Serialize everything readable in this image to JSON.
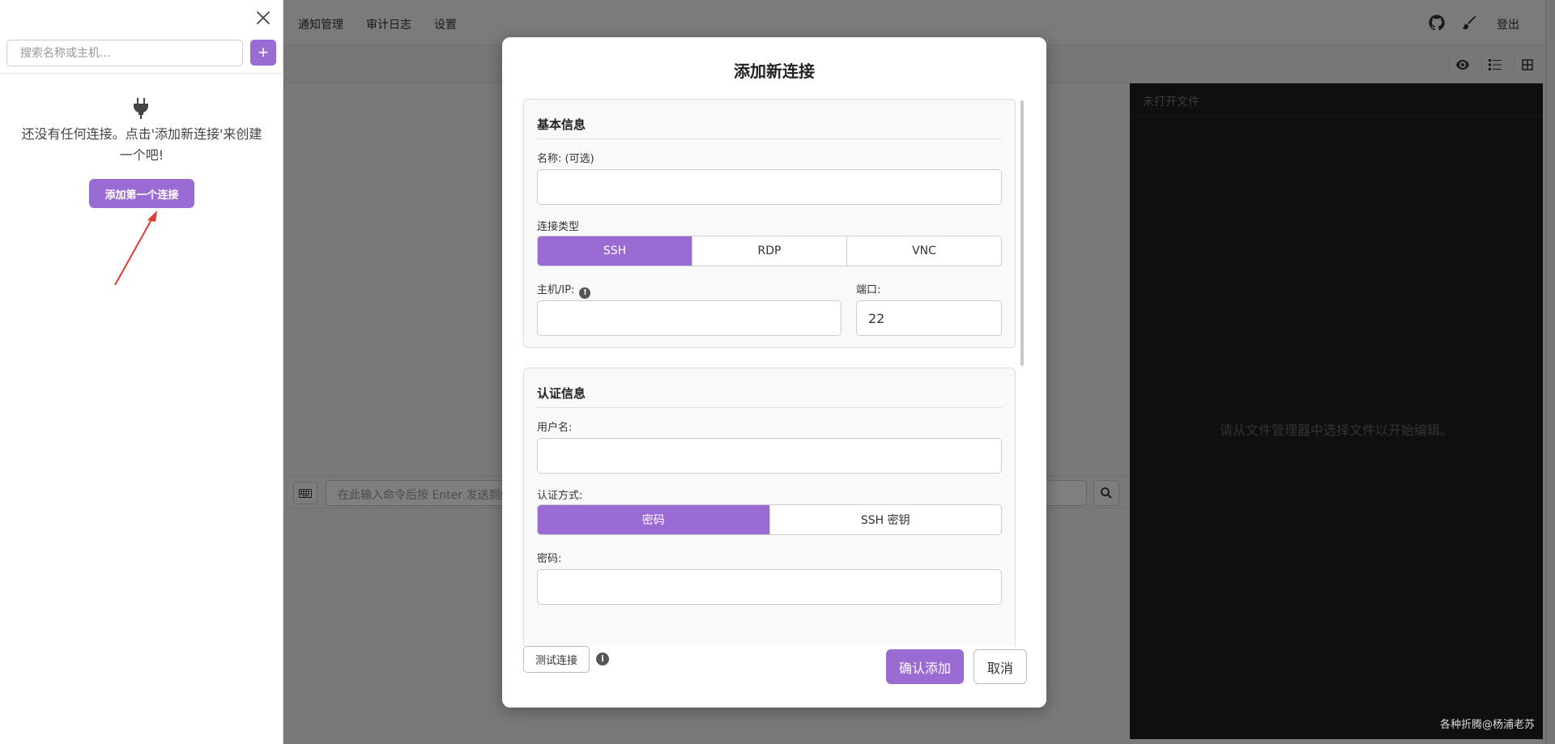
{
  "topnav": {
    "items": [
      "通知管理",
      "审计日志",
      "设置"
    ],
    "logout": "登出",
    "icons": [
      "github-icon",
      "brush-icon"
    ]
  },
  "tabbar": {
    "tools": [
      "eye-icon",
      "list-icon",
      "grid-icon"
    ]
  },
  "editor": {
    "header": "未打开文件",
    "empty_message": "请从文件管理器中选择文件以开始编辑。"
  },
  "command_bar": {
    "placeholder": "在此输入命令后按 Enter 发送到终端..."
  },
  "sidebar": {
    "search_placeholder": "搜索名称或主机...",
    "add_label": "+",
    "empty_text": "还没有任何连接。点击'添加新连接'来创建一个吧!",
    "first_button": "添加第一个连接"
  },
  "modal": {
    "title": "添加新连接",
    "basic": {
      "title": "基本信息",
      "name_label": "名称: (可选)",
      "name_value": "",
      "type_label": "连接类型",
      "types": [
        "SSH",
        "RDP",
        "VNC"
      ],
      "type_selected": "SSH",
      "host_label": "主机/IP:",
      "host_value": "",
      "port_label": "端口:",
      "port_value": "22"
    },
    "auth": {
      "title": "认证信息",
      "username_label": "用户名:",
      "username_value": "",
      "method_label": "认证方式:",
      "methods": [
        "密码",
        "SSH 密钥"
      ],
      "method_selected": "密码",
      "password_label": "密码:",
      "password_value": ""
    },
    "test_button": "测试连接",
    "confirm_button": "确认添加",
    "cancel_button": "取消"
  },
  "watermark": "各种折腾@杨浦老苏",
  "colors": {
    "accent": "#9b6bd4",
    "editor_bg": "#1e1e1e"
  }
}
